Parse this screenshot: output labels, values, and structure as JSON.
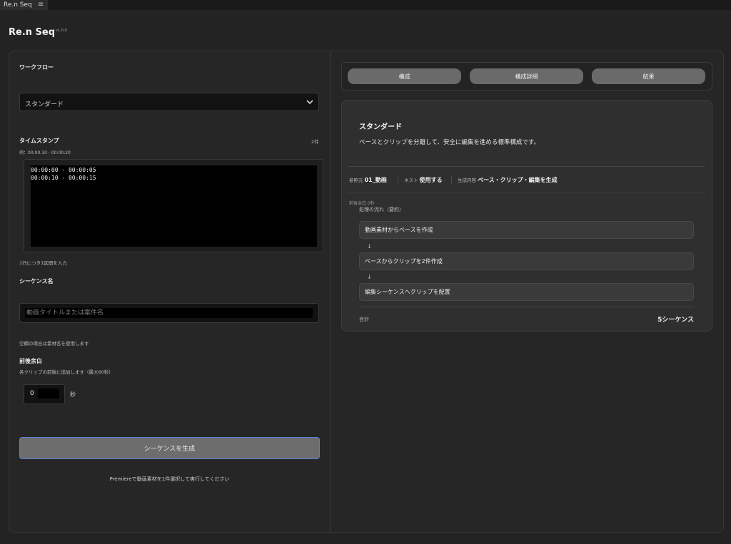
{
  "window": {
    "tab_label": "Re.n Seq",
    "menu_icon": "hamburger-icon"
  },
  "app": {
    "title": "Re.n Seq",
    "version": "v1.0.0"
  },
  "left": {
    "workflow": {
      "label": "ワークフロー",
      "selected": "スタンダード",
      "chevron_icon": "chevron-down-icon"
    },
    "timestamps": {
      "label": "タイムスタンプ",
      "count": "2件",
      "example": "例：00:00:10 - 00:00:20",
      "lines": [
        "00:00:00 - 00:00:05",
        "00:00:10 - 00:00:15"
      ],
      "help": "1行につき1区間を入力"
    },
    "sequence_name": {
      "label": "シーケンス名",
      "placeholder": "動画タイトルまたは案件名",
      "help": "空欄の場合は素材名を使用します"
    },
    "padding": {
      "label": "前後余白",
      "help": "各クリップの前後に追加します（最大60秒）",
      "value": "0",
      "unit": "秒"
    },
    "generate_button": "シーケンスを生成",
    "hint": "Premiereで動画素材を1件選択して実行してください"
  },
  "right": {
    "tabs": [
      "構成",
      "構成詳細",
      "結果"
    ],
    "card": {
      "title": "スタンダード",
      "description": "ベースとクリップを分離して、安全に編集を進める標準構成です。",
      "meta": [
        {
          "label": "参照元",
          "value": "01_動画"
        },
        {
          "label": "ネスト",
          "value": "使用する"
        },
        {
          "label": "生成内容",
          "value": "ベース・クリップ・編集を生成"
        }
      ],
      "padding_note": "前後余白 0秒",
      "flow_title": "処理の流れ（要約）",
      "steps": [
        "動画素材からベースを作成",
        "ベースからクリップを2件作成",
        "編集シーケンスへクリップを配置"
      ],
      "arrow": "↓",
      "total_label": "合計",
      "total_value": "5シーケンス"
    }
  }
}
